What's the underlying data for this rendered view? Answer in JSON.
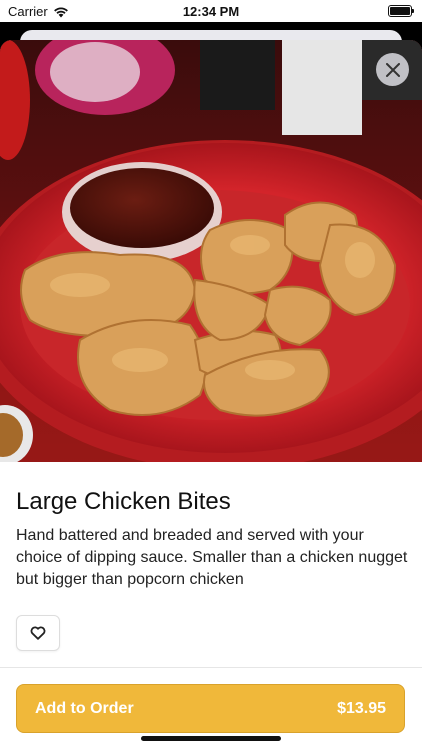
{
  "status_bar": {
    "carrier": "Carrier",
    "time": "12:34 PM",
    "battery_level": 1.0
  },
  "item": {
    "image_description_icon": "food-photo",
    "title": "Large Chicken Bites",
    "description": "Hand battered and breaded and served with your choice of dipping sauce. Smaller than a chicken nugget but bigger than popcorn chicken",
    "favorite_icon": "heart-outline-icon",
    "close_icon": "close-x-icon"
  },
  "order_button": {
    "label": "Add to Order",
    "price": "$13.95"
  },
  "colors": {
    "accent": "#F0B83A",
    "plate_red": "#D7262A"
  }
}
